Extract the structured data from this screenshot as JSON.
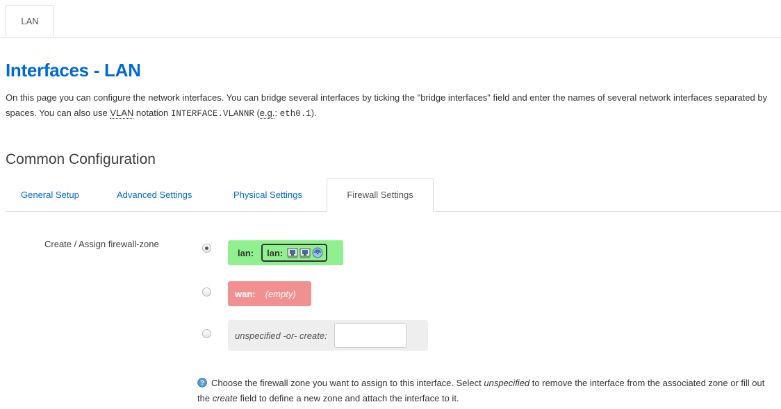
{
  "top_tab": {
    "label": "LAN"
  },
  "page": {
    "title": "Interfaces - LAN",
    "description_part1": "On this page you can configure the network interfaces. You can bridge several interfaces by ticking the \"bridge interfaces\" field and enter the names of several network interfaces separated by spaces. You can also use ",
    "vlan_abbr": "VLAN",
    "description_part2": " notation ",
    "notation_code": "INTERFACE.VLANNR",
    "description_part3": " (",
    "eg_abbr": "e.g.",
    "description_part4": ": ",
    "example_code": "eth0.1",
    "description_part5": ")."
  },
  "section": {
    "title": "Common Configuration"
  },
  "subtabs": [
    {
      "label": "General Setup"
    },
    {
      "label": "Advanced Settings"
    },
    {
      "label": "Physical Settings"
    },
    {
      "label": "Firewall Settings",
      "active": true
    }
  ],
  "firewall": {
    "field_label": "Create / Assign firewall-zone",
    "selected": "lan",
    "zones": [
      {
        "name": "lan:",
        "color": "#90f090",
        "networks": [
          {
            "name": "lan:",
            "icons": [
              "ethernet-port-icon",
              "ethernet-port-icon",
              "wifi-icon"
            ]
          }
        ]
      },
      {
        "name": "wan:",
        "color": "#f09090",
        "empty_label": "(empty)"
      }
    ],
    "create": {
      "label": "unspecified -or- create:",
      "value": ""
    },
    "help_part1": "Choose the firewall zone you want to assign to this interface. Select ",
    "help_unspecified": "unspecified",
    "help_part2": " to remove the interface from the associated zone or fill out the ",
    "help_create": "create",
    "help_part3": " field to define a new zone and attach the interface to it."
  },
  "colors": {
    "link": "#0069d6",
    "lan_zone": "#90f090",
    "wan_zone": "#f09090",
    "create_zone": "#eeeeee"
  }
}
